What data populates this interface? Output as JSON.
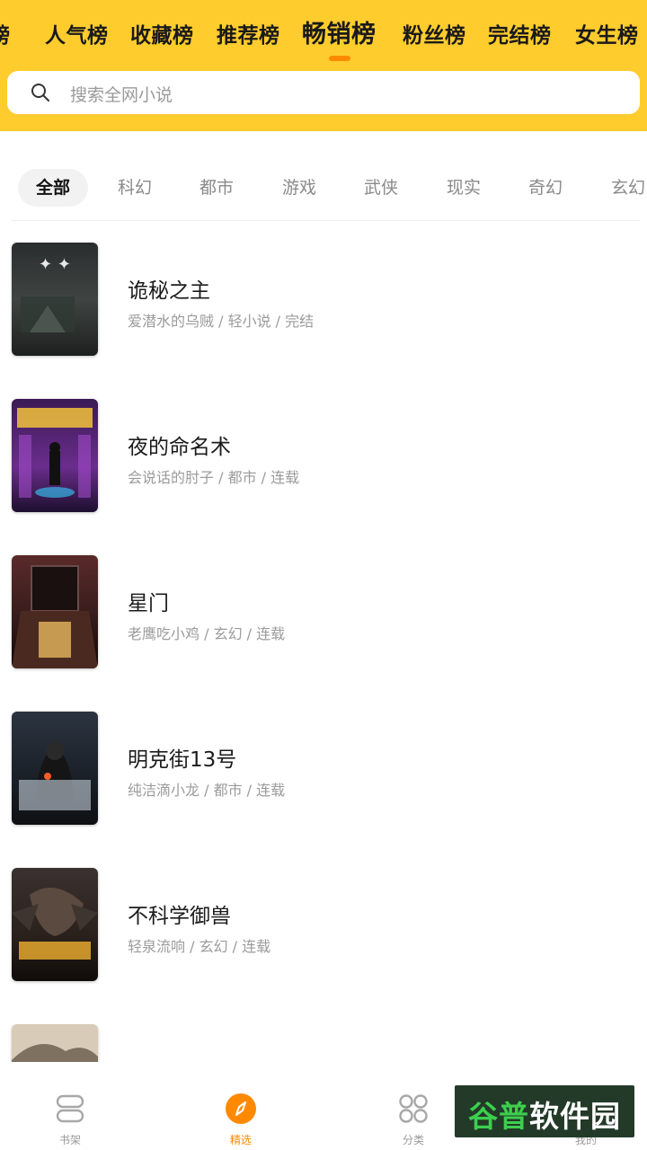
{
  "rank_tabs": [
    {
      "label": "榜"
    },
    {
      "label": "人气榜"
    },
    {
      "label": "收藏榜"
    },
    {
      "label": "推荐榜"
    },
    {
      "label": "畅销榜",
      "active": true
    },
    {
      "label": "粉丝榜"
    },
    {
      "label": "完结榜"
    },
    {
      "label": "女生榜"
    }
  ],
  "search": {
    "placeholder": "搜索全网小说"
  },
  "categories": [
    {
      "label": "全部",
      "active": true
    },
    {
      "label": "科幻"
    },
    {
      "label": "都市"
    },
    {
      "label": "游戏"
    },
    {
      "label": "武侠"
    },
    {
      "label": "现实"
    },
    {
      "label": "奇幻"
    },
    {
      "label": "玄幻"
    }
  ],
  "books": [
    {
      "title": "诡秘之主",
      "meta": "爱潜水的乌贼 / 轻小说 / 完结"
    },
    {
      "title": "夜的命名术",
      "meta": "会说话的肘子 / 都市 / 连载"
    },
    {
      "title": "星门",
      "meta": "老鹰吃小鸡 / 玄幻 / 连载"
    },
    {
      "title": "明克街13号",
      "meta": "纯洁滴小龙 / 都市 / 连载"
    },
    {
      "title": "不科学御兽",
      "meta": "轻泉流响 / 玄幻 / 连载"
    },
    {
      "title": "",
      "meta": ""
    }
  ],
  "bottom_nav": [
    {
      "label": "书架",
      "icon": "bookshelf-icon"
    },
    {
      "label": "精选",
      "icon": "compass-icon",
      "active": true
    },
    {
      "label": "分类",
      "icon": "category-grid-icon"
    },
    {
      "label": "我的",
      "icon": "profile-icon"
    }
  ],
  "watermark": {
    "text_green": "谷普",
    "text_white": "软件园"
  },
  "colors": {
    "header_yellow": "#ffcc2e",
    "accent_orange": "#ff8a00"
  }
}
